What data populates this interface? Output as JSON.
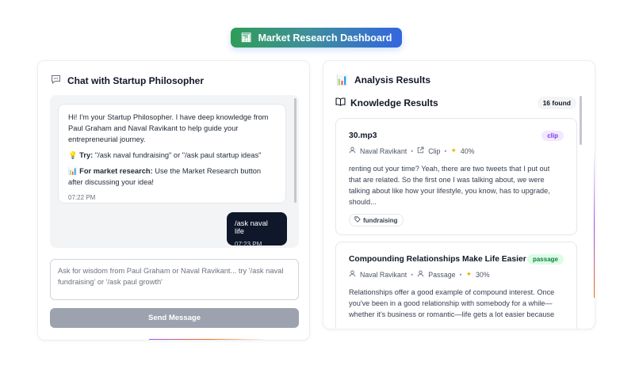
{
  "top_button": {
    "icon": "bar-chart-icon",
    "label": "Market Research Dashboard"
  },
  "chat": {
    "title": "Chat with Startup Philosopher",
    "icon": "speech-bubble-icon",
    "bot_message": {
      "intro": "Hi! I'm your Startup Philosopher. I have deep knowledge from Paul Graham and Naval Ravikant to help guide your entrepreneurial journey.",
      "try_label": "Try:",
      "try_text": " \"/ask naval fundraising\" or \"/ask paul startup ideas\"",
      "market_label": "For market research:",
      "market_text": " Use the Market Research button after discussing your idea!",
      "time": "07:22 PM"
    },
    "user_message": {
      "text": "/ask naval life",
      "time": "07:23 PM"
    },
    "input_placeholder": "Ask for wisdom from Paul Graham or Naval Ravikant... try '/ask naval fundraising' or '/ask paul growth'",
    "send_label": "Send Message"
  },
  "analysis": {
    "title": "Analysis Results",
    "knowledge_title": "Knowledge Results",
    "count_badge": "16 found",
    "results": [
      {
        "title": "30.mp3",
        "tag": "clip",
        "author": "Naval Ravikant",
        "type": "Clip",
        "score": "40%",
        "text": "renting out your time? Yeah, there are two tweets that I put out that are related. So the first one I was talking about, we were talking about like how your lifestyle, you know, has to upgrade, should...",
        "keyword": "fundraising"
      },
      {
        "title": "Compounding Relationships Make Life Easier",
        "tag": "passage",
        "author": "Naval Ravikant",
        "type": "Passage",
        "score": "30%",
        "text": "Relationships offer a good example of compound interest. Once you've been in a good relationship with somebody for a while—whether it's business or romantic—life gets a lot easier because"
      }
    ]
  }
}
